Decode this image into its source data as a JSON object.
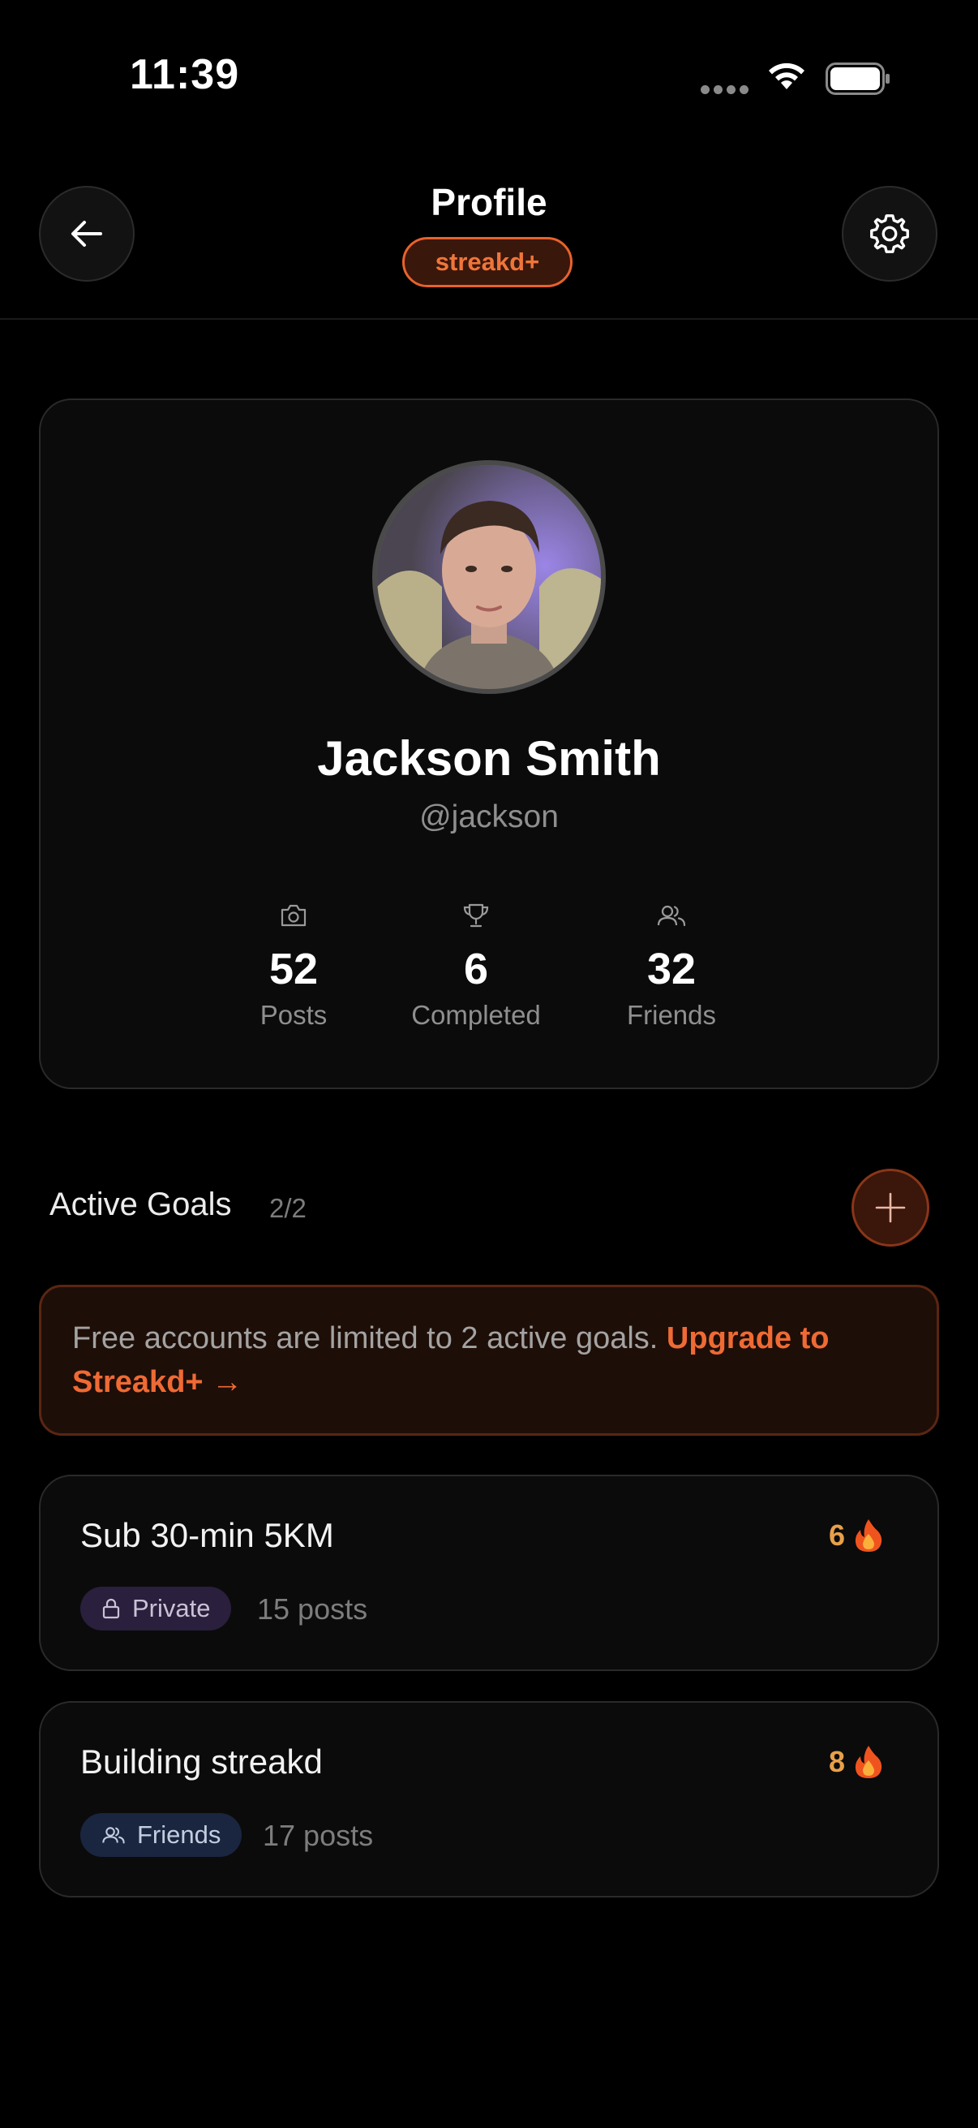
{
  "status_bar": {
    "time": "11:39"
  },
  "header": {
    "title": "Profile",
    "badge": "streakd+"
  },
  "profile": {
    "name": "Jackson Smith",
    "handle": "@jackson",
    "stats": [
      {
        "icon": "camera-icon",
        "value": "52",
        "label": "Posts"
      },
      {
        "icon": "trophy-icon",
        "value": "6",
        "label": "Completed"
      },
      {
        "icon": "users-icon",
        "value": "32",
        "label": "Friends"
      }
    ]
  },
  "goals": {
    "title": "Active Goals",
    "count": "2/2",
    "limit_text": "Free accounts are limited to 2 active goals.",
    "upgrade_text": "Upgrade to Streakd+ →",
    "items": [
      {
        "title": "Sub 30-min 5KM",
        "streak": "6",
        "privacy": "Private",
        "posts": "15 posts"
      },
      {
        "title": "Building streakd",
        "streak": "8",
        "privacy": "Friends",
        "posts": "17 posts"
      }
    ]
  },
  "colors": {
    "accent": "#ef6a34",
    "streak": "#e8a04a",
    "background": "#000000",
    "card": "#0b0b0b"
  }
}
